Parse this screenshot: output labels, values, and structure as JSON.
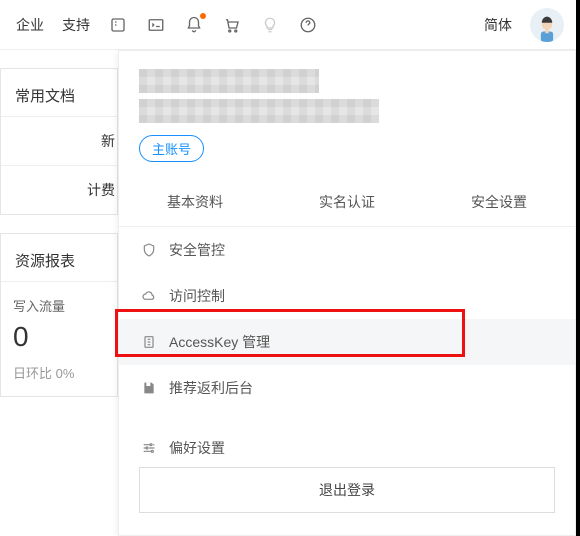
{
  "topbar": {
    "enterprise": "企业",
    "support": "支持",
    "lang": "简体"
  },
  "left": {
    "docsTitle": "常用文档",
    "stub1": "新",
    "stub2": "计费",
    "resourceTitle": "资源报表",
    "metricLabel": "写入流量",
    "metricValue": "0",
    "metricDelta": "日环比 0%"
  },
  "dropdown": {
    "accountBadge": "主账号",
    "tabs": {
      "profile": "基本资料",
      "realname": "实名认证",
      "security": "安全设置"
    },
    "items": {
      "secureControl": "安全管控",
      "accessControl": "访问控制",
      "accessKey": "AccessKey 管理",
      "rebate": "推荐返利后台",
      "preferences": "偏好设置"
    },
    "logout": "退出登录"
  }
}
